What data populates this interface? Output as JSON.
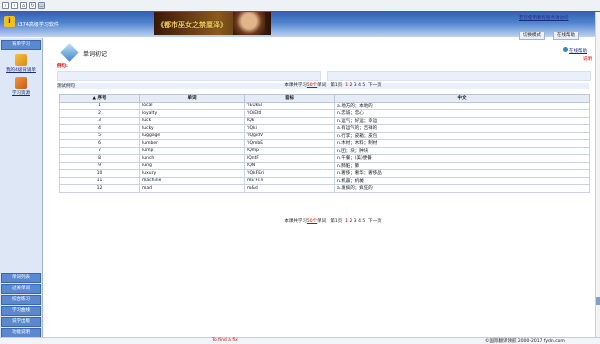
{
  "app": {
    "name": "i374高级学习软件"
  },
  "banner": {
    "ad_title": "《都市巫女之禁厘泽》",
    "link": "若您使用教程服务请访问",
    "btn_switch": "切换模式",
    "btn_help": "在线帮助"
  },
  "sidebar": {
    "top_button": "背单学习",
    "item1_label": "我的4级背诵单",
    "item2_label": "学习资源",
    "bottom_items": [
      "单词列表",
      "过关单词",
      "综合练习",
      "学习曲线",
      "说学出版",
      "功能说明"
    ]
  },
  "main": {
    "title": "单词初记",
    "red_label": "例句:",
    "help_label": "在线帮助",
    "red_link": "说明",
    "mode_label": "测试例句"
  },
  "pager": {
    "prefix": "本课共学习",
    "count": "50个",
    "mid": "单词",
    "page_info": "第1页",
    "pages": [
      "1",
      "2",
      "3",
      "4",
      "5"
    ],
    "next": "下一页"
  },
  "table": {
    "headers": [
      "▲ 序号",
      "单词",
      "音标",
      "中文"
    ],
    "rows": [
      {
        "no": "1",
        "word": "local",
        "phon": "'lEUkEl",
        "cn": "a.地方的；本地的"
      },
      {
        "no": "2",
        "word": "loyalty",
        "phon": "'lOiEltI",
        "cn": "n.忠诚；忠心"
      },
      {
        "no": "3",
        "word": "luck",
        "phon": "lQk",
        "cn": "n.运气；好运；幸运"
      },
      {
        "no": "4",
        "word": "lucky",
        "phon": "'lQki",
        "cn": "a.有运气的；吉祥的"
      },
      {
        "no": "5",
        "word": "luggage",
        "phon": "'lQgidV",
        "cn": "n.行李；皮箱；皮包"
      },
      {
        "no": "6",
        "word": "lumber",
        "phon": "'lQmbE",
        "cn": "n.木材；木料；制材"
      },
      {
        "no": "7",
        "word": "lump",
        "phon": "lQmp",
        "cn": "n.团；块；肿块"
      },
      {
        "no": "8",
        "word": "lunch",
        "phon": "lQntF",
        "cn": "n.午餐；(美)便餐"
      },
      {
        "no": "9",
        "word": "lung",
        "phon": "lQN",
        "cn": "n.肺脏；肺"
      },
      {
        "no": "10",
        "word": "luxury",
        "phon": "'lQkFEri",
        "cn": "n.奢侈；奢华；奢侈品"
      },
      {
        "no": "11",
        "word": "machine",
        "phon": "mE'Fi:n",
        "cn": "n.机器；机械"
      },
      {
        "no": "12",
        "word": "mad",
        "phon": "m&d",
        "cn": "a.发疯的；疯狂的"
      }
    ]
  },
  "footer": {
    "red": "To find a fix",
    "copyright": "©国际翻译领航 2000-2017 fydn.com"
  }
}
